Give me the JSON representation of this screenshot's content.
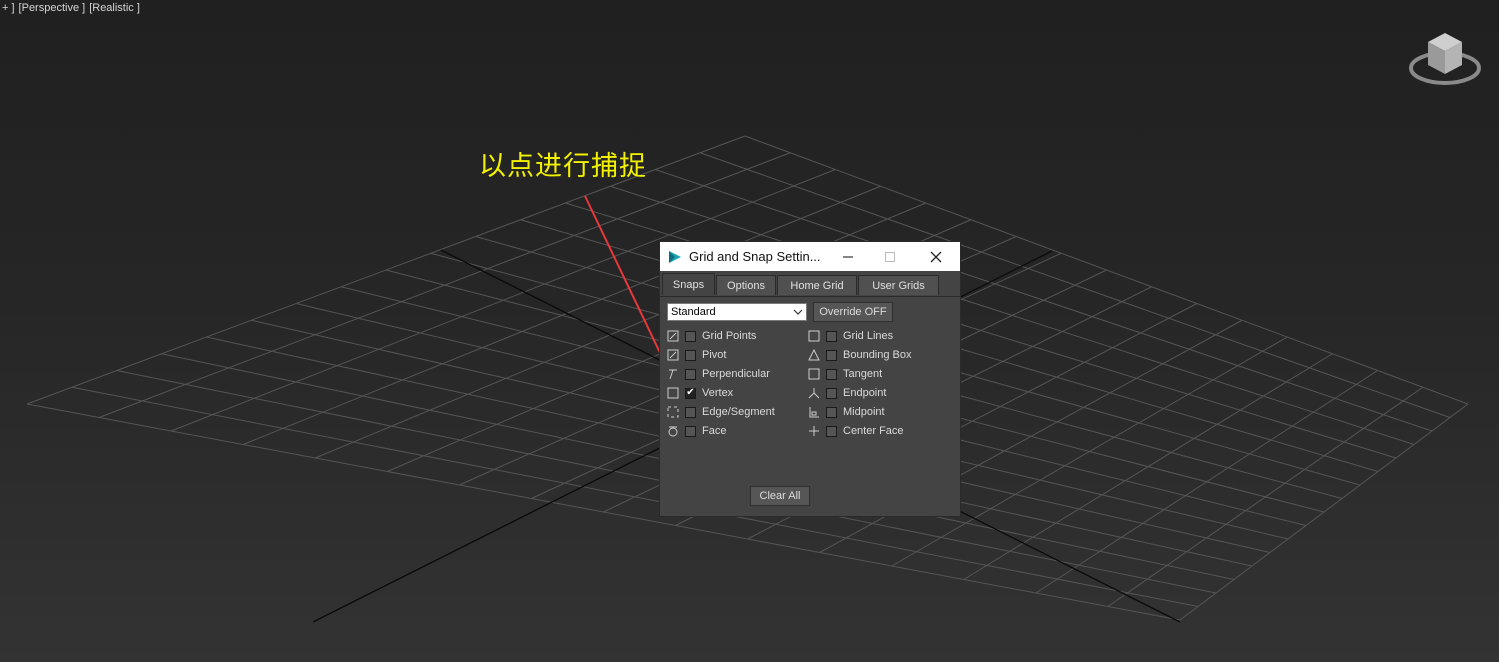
{
  "viewport": {
    "labels": [
      "+ ]",
      "[Perspective ]",
      "[Realistic ]"
    ]
  },
  "annotation": {
    "text": "以点进行捕捉",
    "color": "#f2f200"
  },
  "dialog": {
    "title": "Grid and Snap Settin...",
    "tabs": [
      {
        "label": "Snaps",
        "active": true
      },
      {
        "label": "Options",
        "active": false
      },
      {
        "label": "Home Grid",
        "active": false
      },
      {
        "label": "User Grids",
        "active": false
      }
    ],
    "snap_set": "Standard",
    "override_label": "Override OFF",
    "clear_all_label": "Clear All",
    "snaps_left": [
      {
        "label": "Grid Points",
        "checked": false,
        "icon": "grid-points-icon"
      },
      {
        "label": "Pivot",
        "checked": false,
        "icon": "pivot-icon"
      },
      {
        "label": "Perpendicular",
        "checked": false,
        "icon": "perpendicular-icon"
      },
      {
        "label": "Vertex",
        "checked": true,
        "icon": "vertex-icon"
      },
      {
        "label": "Edge/Segment",
        "checked": false,
        "icon": "edge-segment-icon"
      },
      {
        "label": "Face",
        "checked": false,
        "icon": "face-icon"
      }
    ],
    "snaps_right": [
      {
        "label": "Grid Lines",
        "checked": false,
        "icon": "grid-lines-icon"
      },
      {
        "label": "Bounding Box",
        "checked": false,
        "icon": "bounding-box-icon"
      },
      {
        "label": "Tangent",
        "checked": false,
        "icon": "tangent-icon"
      },
      {
        "label": "Endpoint",
        "checked": false,
        "icon": "endpoint-icon"
      },
      {
        "label": "Midpoint",
        "checked": false,
        "icon": "midpoint-icon"
      },
      {
        "label": "Center Face",
        "checked": false,
        "icon": "center-face-icon"
      }
    ]
  },
  "colors": {
    "arrow": "#e8383a",
    "grid_line": "#555555",
    "axis_line": "#0a0a0a"
  }
}
